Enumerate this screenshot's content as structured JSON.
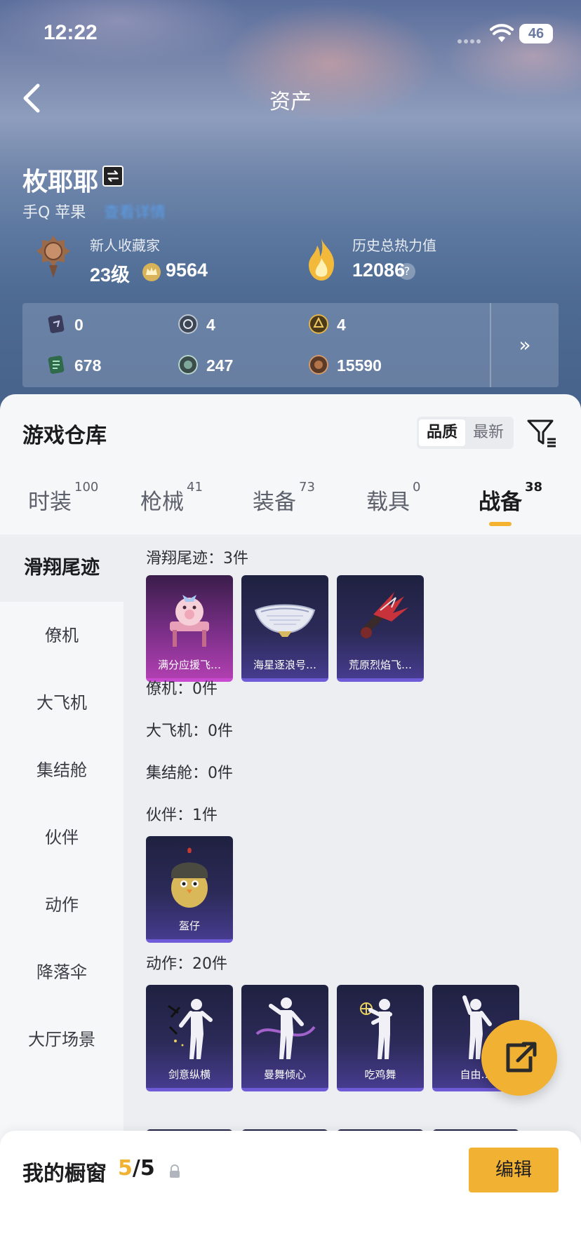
{
  "status": {
    "time": "12:22",
    "battery": "46"
  },
  "header": {
    "title": "资产",
    "back_icon": "chevron-left-icon"
  },
  "profile": {
    "name": "枚耶耶",
    "platform": "手Q 苹果",
    "platform_link": "查看详情",
    "collector_title": "新人收藏家",
    "level": "23级",
    "points": "9564",
    "heat_label": "历史总热力值",
    "heat_value": "12086",
    "help": "?"
  },
  "currencies": [
    {
      "icon": "card-dark-icon",
      "value": "0"
    },
    {
      "icon": "silver-coin-icon",
      "value": "4"
    },
    {
      "icon": "gold-coin-icon",
      "value": "4"
    },
    {
      "icon": "card-green-icon",
      "value": "678"
    },
    {
      "icon": "green-coin-icon",
      "value": "247"
    },
    {
      "icon": "bronze-coin-icon",
      "value": "15590"
    }
  ],
  "currency_more": "»",
  "warehouse": {
    "title": "游戏仓库",
    "sort_options": [
      "品质",
      "最新"
    ],
    "sort_selected": "品质"
  },
  "tabs": [
    {
      "label": "时装",
      "count": "100"
    },
    {
      "label": "枪械",
      "count": "41"
    },
    {
      "label": "装备",
      "count": "73"
    },
    {
      "label": "载具",
      "count": "0"
    },
    {
      "label": "战备",
      "count": "38"
    }
  ],
  "active_tab": "战备",
  "sidebar": [
    "滑翔尾迹",
    "僚机",
    "大飞机",
    "集结舱",
    "伙伴",
    "动作",
    "降落伞",
    "大厅场景"
  ],
  "sections": {
    "trail": {
      "label": "滑翔尾迹：3件",
      "items": [
        "满分应援飞…",
        "海星逐浪号…",
        "荒原烈焰飞…"
      ]
    },
    "wingman": {
      "label": "僚机：0件"
    },
    "plane": {
      "label": "大飞机：0件"
    },
    "pod": {
      "label": "集结舱：0件"
    },
    "partner": {
      "label": "伙伴：1件",
      "items": [
        "盔仔"
      ]
    },
    "emote": {
      "label": "动作：20件",
      "items": [
        "剑意纵横",
        "曼舞倾心",
        "吃鸡舞",
        "自由…"
      ]
    }
  },
  "showcase": {
    "title": "我的橱窗",
    "current": "5",
    "total": "/5",
    "edit": "编辑"
  },
  "colors": {
    "accent": "#f1b233",
    "link": "#58a8ff",
    "card_purple": "#453c8e",
    "card_pink": "#b03fb0"
  }
}
